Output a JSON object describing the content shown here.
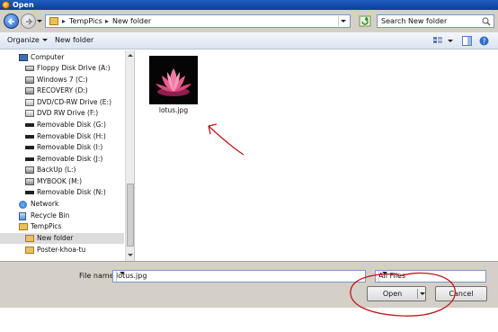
{
  "window": {
    "title": "Open"
  },
  "address": {
    "crumbs": [
      "TempPics",
      "New folder"
    ],
    "separator": "▸"
  },
  "search": {
    "placeholder": "Search New folder"
  },
  "toolbar": {
    "organize_label": "Organize",
    "new_folder_label": "New folder"
  },
  "nav": {
    "items": [
      {
        "label": "Computer",
        "icon": "computer-icon"
      },
      {
        "label": "Floppy Disk Drive (A:)",
        "icon": "floppy-drive-icon"
      },
      {
        "label": "Windows 7 (C:)",
        "icon": "windows-drive-icon"
      },
      {
        "label": "RECOVERY (D:)",
        "icon": "drive-icon"
      },
      {
        "label": "DVD/CD-RW Drive (E:)",
        "icon": "dvd-drive-icon"
      },
      {
        "label": "DVD RW Drive (F:)",
        "icon": "dvd-drive-icon"
      },
      {
        "label": "Removable Disk (G:)",
        "icon": "removable-disk-icon"
      },
      {
        "label": "Removable Disk (H:)",
        "icon": "removable-disk-icon"
      },
      {
        "label": "Removable Disk (I:)",
        "icon": "removable-disk-icon"
      },
      {
        "label": "Removable Disk (J:)",
        "icon": "removable-disk-icon"
      },
      {
        "label": "BackUp (L:)",
        "icon": "drive-icon"
      },
      {
        "label": "MYBOOK (M:)",
        "icon": "drive-icon"
      },
      {
        "label": "Removable Disk (N:)",
        "icon": "removable-disk-icon"
      },
      {
        "label": "Network",
        "icon": "network-icon"
      },
      {
        "label": "Recycle Bin",
        "icon": "recycle-bin-icon"
      },
      {
        "label": "TempPics",
        "icon": "folder-icon"
      },
      {
        "label": "New folder",
        "icon": "folder-icon",
        "selected": true
      },
      {
        "label": "Poster-khoa-tu",
        "icon": "folder-icon"
      }
    ]
  },
  "content": {
    "files": [
      {
        "name": "lotus.jpg",
        "thumbnail": "lotus-flower-image"
      }
    ],
    "annotation_color": "#c0161b"
  },
  "bottom": {
    "file_name_label": "File name:",
    "file_name_value": "lotus.jpg",
    "file_type_value": "All Files",
    "open_label": "Open",
    "cancel_label": "Cancel"
  }
}
